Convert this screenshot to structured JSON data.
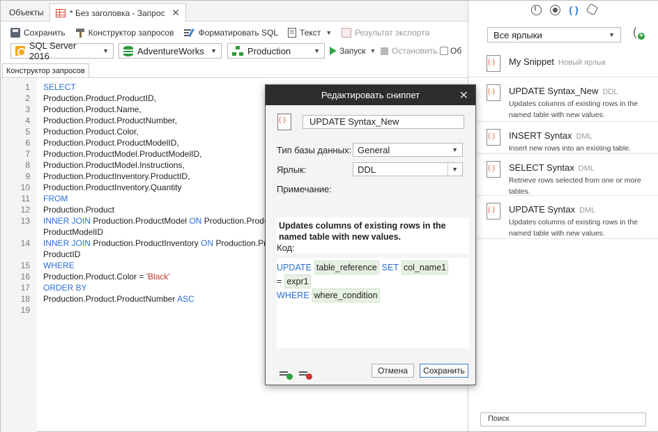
{
  "tabs": {
    "objects_label": "Объекты",
    "active_label": "* Без заголовка - Запрос",
    "close_glyph": "✕"
  },
  "toolbar": {
    "save_label": "Сохранить",
    "query_builder_label": "Конструктор запросов",
    "format_sql_label": "Форматировать SQL",
    "text_label": "Текст",
    "export_result_label": "Результат экспорта"
  },
  "connection": {
    "server": "SQL Server 2016",
    "database": "AdventureWorks",
    "schema": "Production",
    "run_label": "Запуск",
    "stop_label": "Остановить",
    "more_label": "Об"
  },
  "doc_tab_label": "Конструктор запросов",
  "editor": {
    "lines": [
      {
        "n": "1",
        "parts": [
          {
            "t": "SELECT",
            "c": "kw"
          }
        ]
      },
      {
        "n": "2",
        "parts": [
          {
            "t": "Production.Product.ProductID,",
            "c": ""
          }
        ]
      },
      {
        "n": "3",
        "parts": [
          {
            "t": "Production.Product.Name,",
            "c": ""
          }
        ]
      },
      {
        "n": "4",
        "parts": [
          {
            "t": "Production.Product.ProductNumber,",
            "c": ""
          }
        ]
      },
      {
        "n": "5",
        "parts": [
          {
            "t": "Production.Product.Color,",
            "c": ""
          }
        ]
      },
      {
        "n": "6",
        "parts": [
          {
            "t": "Production.Product.ProductModelID,",
            "c": ""
          }
        ]
      },
      {
        "n": "7",
        "parts": [
          {
            "t": "Production.ProductModel.ProductModelID,",
            "c": ""
          }
        ]
      },
      {
        "n": "8",
        "parts": [
          {
            "t": "Production.ProductModel.Instructions,",
            "c": ""
          }
        ]
      },
      {
        "n": "9",
        "parts": [
          {
            "t": "Production.ProductInventory.ProductID,",
            "c": ""
          }
        ]
      },
      {
        "n": "10",
        "parts": [
          {
            "t": "Production.ProductInventory.Quantity",
            "c": ""
          }
        ]
      },
      {
        "n": "11",
        "parts": [
          {
            "t": "FROM",
            "c": "kw"
          }
        ]
      },
      {
        "n": "12",
        "parts": [
          {
            "t": "Production.Product",
            "c": ""
          }
        ]
      },
      {
        "n": "13",
        "parts": [
          {
            "t": "INNER JOIN",
            "c": "kw"
          },
          {
            "t": " Production.ProductModel ",
            "c": ""
          },
          {
            "t": "ON",
            "c": "kw"
          },
          {
            "t": " Production.Product",
            "c": ""
          }
        ]
      },
      {
        "n": "",
        "parts": [
          {
            "t": "ProductModelID",
            "c": ""
          }
        ]
      },
      {
        "n": "14",
        "parts": [
          {
            "t": "INNER JOIN",
            "c": "kw"
          },
          {
            "t": " Production.ProductInventory ",
            "c": ""
          },
          {
            "t": "ON",
            "c": "kw"
          },
          {
            "t": " Production.Pro",
            "c": ""
          }
        ]
      },
      {
        "n": "",
        "parts": [
          {
            "t": "ProductID",
            "c": ""
          }
        ]
      },
      {
        "n": "15",
        "parts": [
          {
            "t": "WHERE",
            "c": "kw"
          }
        ]
      },
      {
        "n": "16",
        "parts": [
          {
            "t": "Production.Product.Color = ",
            "c": ""
          },
          {
            "t": "'Black'",
            "c": "str"
          }
        ]
      },
      {
        "n": "17",
        "parts": [
          {
            "t": "ORDER BY",
            "c": "kw"
          }
        ]
      },
      {
        "n": "18",
        "parts": [
          {
            "t": "Production.Product.ProductNumber ",
            "c": ""
          },
          {
            "t": "ASC",
            "c": "kw"
          }
        ]
      },
      {
        "n": "19",
        "parts": []
      }
    ]
  },
  "dialog": {
    "title": "Редактировать сниппет",
    "name_value": "UPDATE Syntax_New",
    "db_type_label": "Тип базы данных:",
    "db_type_value": "General",
    "label_label": "Ярлык:",
    "label_value": "DDL",
    "note_label": "Примечание:",
    "note_text": "Updates columns of existing rows in the named table with new values.",
    "code_label": "Код:",
    "code_line1": {
      "kw": "UPDATE",
      "ph1": "table_reference",
      "kw2": "SET",
      "ph2": "col_name1"
    },
    "code_line2": {
      "op": "=",
      "ph": "expr1"
    },
    "code_line3": {
      "kw": "WHERE",
      "ph": "where_condition"
    },
    "cancel_label": "Отмена",
    "save_label": "Сохранить"
  },
  "right_panel": {
    "filter_value": "Все ярлыки",
    "snippets": [
      {
        "title": "My Snippet",
        "tag": "Новый ярлык",
        "desc": ""
      },
      {
        "title": "UPDATE Syntax_New",
        "tag": "DDL",
        "desc": "Updates columns of existing rows in the named table with new values."
      },
      {
        "title": "INSERT Syntax",
        "tag": "DML",
        "desc": "Insert new rows into an existing table."
      },
      {
        "title": "SELECT Syntax",
        "tag": "DML",
        "desc": "Retrieve rows selected from one or more tables."
      },
      {
        "title": "UPDATE Syntax",
        "tag": "DML",
        "desc": "Updates columns of existing rows in the named table with new values."
      }
    ],
    "search_placeholder": "Поиск"
  },
  "colors": {
    "keyword": "#2a6fd6",
    "string": "#c0392b",
    "dialog_title_bg": "#2d2d30",
    "placeholder_bg": "#e6f1e3"
  }
}
